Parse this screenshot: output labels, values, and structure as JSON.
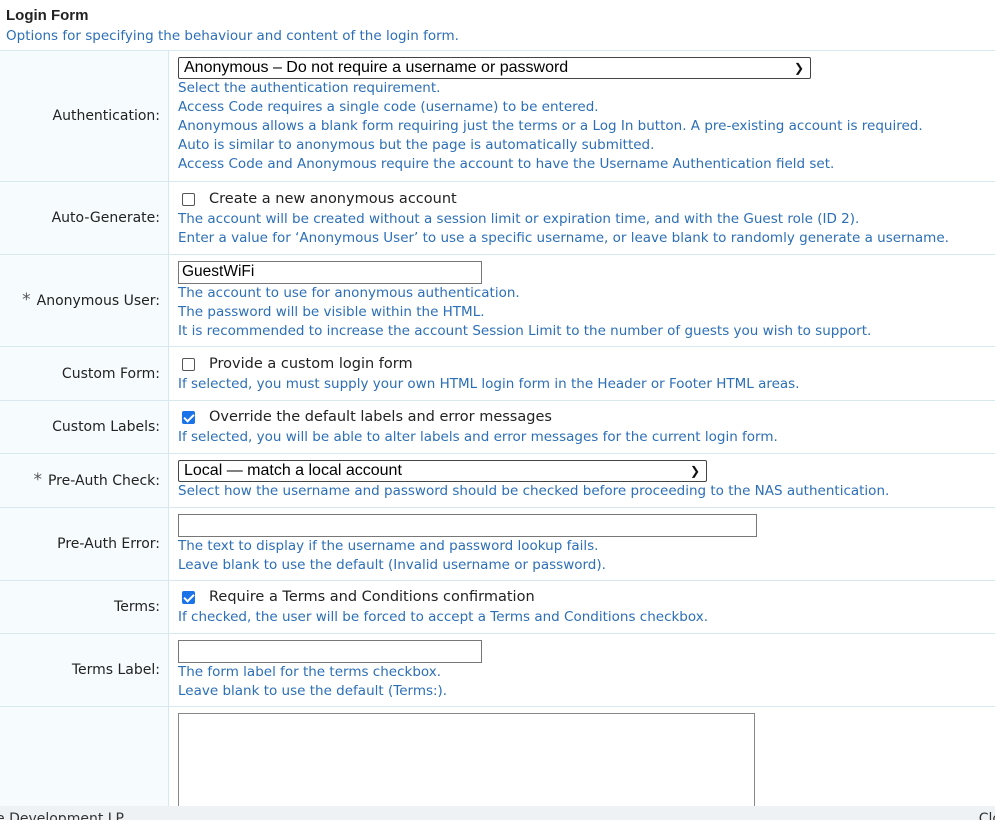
{
  "header": {
    "title": "Login Form",
    "subtitle": "Options for specifying the behaviour and content of the login form."
  },
  "rows": {
    "authentication": {
      "label": "Authentication:",
      "selected": "Anonymous – Do not require a username or password",
      "help": [
        "Select the authentication requirement.",
        "Access Code requires a single code (username) to be entered.",
        "Anonymous allows a blank form requiring just the terms or a Log In button. A pre-existing account is required.",
        "Auto is similar to anonymous but the page is automatically submitted.",
        "Access Code and Anonymous require the account to have the Username Authentication field set."
      ]
    },
    "auto_generate": {
      "label": "Auto-Generate:",
      "checkbox_label": "Create a new anonymous account",
      "checked": false,
      "help": [
        "The account will be created without a session limit or expiration time, and with the Guest role (ID 2).",
        "Enter a value for ‘Anonymous User’ to use a specific username, or leave blank to randomly generate a username."
      ]
    },
    "anonymous_user": {
      "required_mark": "*",
      "label": "Anonymous User:",
      "value": "GuestWiFi",
      "help": [
        "The account to use for anonymous authentication.",
        "The password will be visible within the HTML.",
        "It is recommended to increase the account Session Limit to the number of guests you wish to support."
      ]
    },
    "custom_form": {
      "label": "Custom Form:",
      "checkbox_label": "Provide a custom login form",
      "checked": false,
      "help": [
        "If selected, you must supply your own HTML login form in the Header or Footer HTML areas."
      ]
    },
    "custom_labels": {
      "label": "Custom Labels:",
      "checkbox_label": "Override the default labels and error messages",
      "checked": true,
      "help": [
        "If selected, you will be able to alter labels and error messages for the current login form."
      ]
    },
    "pre_auth_check": {
      "required_mark": "*",
      "label": "Pre-Auth Check:",
      "selected": "Local — match a local account",
      "help": [
        "Select how the username and password should be checked before proceeding to the NAS authentication."
      ]
    },
    "pre_auth_error": {
      "label": "Pre-Auth Error:",
      "value": "",
      "help": [
        "The text to display if the username and password lookup fails.",
        "Leave blank to use the default (Invalid username or password)."
      ]
    },
    "terms": {
      "label": "Terms:",
      "checkbox_label": "Require a Terms and Conditions confirmation",
      "checked": true,
      "help": [
        "If checked, the user will be forced to accept a Terms and Conditions checkbox."
      ]
    },
    "terms_label": {
      "label": "Terms Label:",
      "value": "",
      "help": [
        "The form label for the terms checkbox.",
        "Leave blank to use the default (Terms:)."
      ]
    }
  },
  "footer": {
    "left_text": "e Development LP",
    "right_text": "Clo"
  },
  "colors": {
    "help_text": "#2c6fb7",
    "label_bg": "#f6fcfe",
    "border": "#d7e8ee",
    "checkbox_checked": "#1a73e8"
  }
}
